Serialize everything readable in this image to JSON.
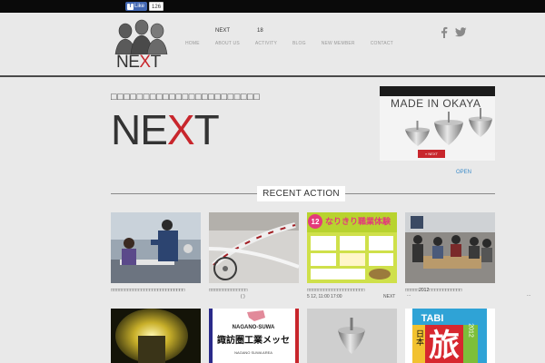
{
  "facebook": {
    "like_label": "Like",
    "count": "126"
  },
  "logo": {
    "text_before": "NE",
    "text_x": "X",
    "text_after": "T"
  },
  "nav_top": [
    "NEXT",
    "18"
  ],
  "nav": [
    "HOME",
    "ABOUT US",
    "ACTIVITY",
    "BLOG",
    "NEW MEMBER",
    "CONTACT"
  ],
  "social": {
    "facebook_icon": "facebook-icon",
    "twitter_icon": "twitter-icon"
  },
  "hero": {
    "caption": "□□□□□□□□□□□□□□□□□□□□□□□",
    "title_before": "NE",
    "title_x": "X",
    "title_after": "T"
  },
  "banner": {
    "title": "MADE IN OKAYA",
    "button": "» NEXT",
    "open_label": "OPEN"
  },
  "section": {
    "title": "RECENT ACTION"
  },
  "cards_row1": [
    {
      "caption": "□□□□□□□□□□□□□□□□□□□□□□□□□□□",
      "sub": ""
    },
    {
      "caption": "□□□□□□□□□□□□□□",
      "sub": "( )"
    },
    {
      "caption": "□□□□□□□□□□□□□□□□□□□□□",
      "sub": "5  12,      11:00  17:00"
    },
    {
      "caption": "□□□□□2012□□□□□□□□□□□□",
      "sub": "..."
    }
  ],
  "cards_row1_extra": {
    "next_label": "NEXT",
    "more_label": "..."
  },
  "flyer": {
    "number": "12",
    "headline": "なりきり職業体験"
  },
  "messe": {
    "top": "NAGANO-SUWA",
    "main": "諏訪圏工業メッセ",
    "bottom": "NAGANO SUWA AREA"
  },
  "tabi": {
    "word": "TABI",
    "kanji": "旅",
    "side": "日本",
    "year": "2012"
  },
  "colors": {
    "accent": "#c8262c",
    "link": "#3b8bc9",
    "header_rule": "#4a4a4a"
  }
}
